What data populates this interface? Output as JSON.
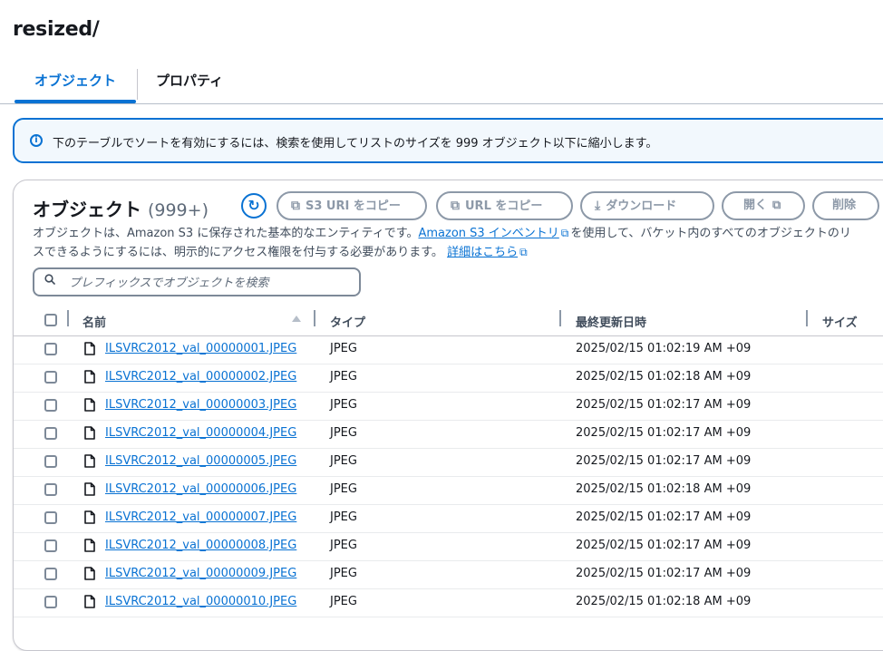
{
  "page": {
    "title": "resized/"
  },
  "tabs": [
    {
      "label": "オブジェクト",
      "active": true
    },
    {
      "label": "プロパティ",
      "active": false
    }
  ],
  "info_banner": {
    "icon": "info-icon",
    "text": "下のテーブルでソートを有効にするには、検索を使用してリストのサイズを 999 オブジェクト以下に縮小します。"
  },
  "objects_panel": {
    "title": "オブジェクト",
    "count": "(999+)",
    "buttons": {
      "refresh": "refresh-icon",
      "copy_s3_uri": "S3 URI をコピー",
      "copy_url": "URL をコピー",
      "download": "ダウンロード",
      "open": "開く",
      "delete": "削除"
    },
    "description": {
      "part1": "オブジェクトは、Amazon S3 に保存された基本的なエンティティです。",
      "inventory_link": "Amazon S3 インベントリ",
      "part2": "を使用して、バケット内のすべてのオブジェクトのリストを取得できます。他のユーザーがオブジェクトにアクセスできるようにするには、明示的にアクセス権限を付与する必要があります。",
      "line2_visible": "スできるようにするには、明示的にアクセス権限を付与する必要があります。",
      "line1_visible": "を使用して、バケット内のすべてのオブジェクトのリ",
      "details_link": "詳細はこちら"
    },
    "search": {
      "placeholder": "プレフィックスでオブジェクトを検索"
    },
    "columns": {
      "name": "名前",
      "type": "タイプ",
      "modified": "最終更新日時",
      "size": "サイズ"
    },
    "rows": [
      {
        "name": "ILSVRC2012_val_00000001.JPEG",
        "type": "JPEG",
        "modified": "2025/02/15 01:02:19 AM +09"
      },
      {
        "name": "ILSVRC2012_val_00000002.JPEG",
        "type": "JPEG",
        "modified": "2025/02/15 01:02:18 AM +09"
      },
      {
        "name": "ILSVRC2012_val_00000003.JPEG",
        "type": "JPEG",
        "modified": "2025/02/15 01:02:17 AM +09"
      },
      {
        "name": "ILSVRC2012_val_00000004.JPEG",
        "type": "JPEG",
        "modified": "2025/02/15 01:02:17 AM +09"
      },
      {
        "name": "ILSVRC2012_val_00000005.JPEG",
        "type": "JPEG",
        "modified": "2025/02/15 01:02:17 AM +09"
      },
      {
        "name": "ILSVRC2012_val_00000006.JPEG",
        "type": "JPEG",
        "modified": "2025/02/15 01:02:18 AM +09"
      },
      {
        "name": "ILSVRC2012_val_00000007.JPEG",
        "type": "JPEG",
        "modified": "2025/02/15 01:02:17 AM +09"
      },
      {
        "name": "ILSVRC2012_val_00000008.JPEG",
        "type": "JPEG",
        "modified": "2025/02/15 01:02:17 AM +09"
      },
      {
        "name": "ILSVRC2012_val_00000009.JPEG",
        "type": "JPEG",
        "modified": "2025/02/15 01:02:17 AM +09"
      },
      {
        "name": "ILSVRC2012_val_00000010.JPEG",
        "type": "JPEG",
        "modified": "2025/02/15 01:02:18 AM +09"
      }
    ]
  },
  "colors": {
    "accent": "#0972d3",
    "text": "#16191f",
    "disabled": "#8d99a8"
  }
}
